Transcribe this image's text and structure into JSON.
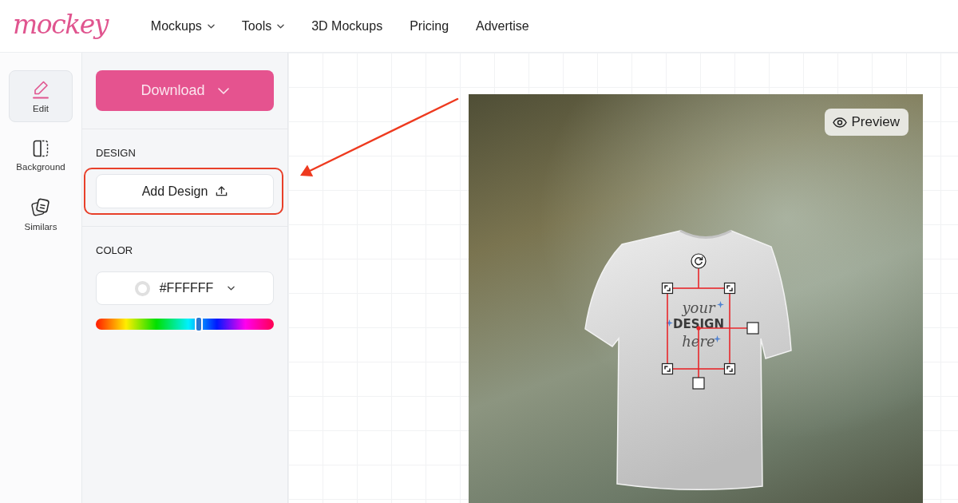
{
  "header": {
    "logo": "mockey",
    "nav": [
      {
        "label": "Mockups",
        "dropdown": true
      },
      {
        "label": "Tools",
        "dropdown": true
      },
      {
        "label": "3D Mockups",
        "dropdown": false
      },
      {
        "label": "Pricing",
        "dropdown": false
      },
      {
        "label": "Advertise",
        "dropdown": false
      }
    ]
  },
  "rail": {
    "items": [
      {
        "kind": "edit",
        "label": "Edit",
        "selected": true
      },
      {
        "kind": "background",
        "label": "Background",
        "selected": false
      },
      {
        "kind": "similars",
        "label": "Similars",
        "selected": false
      }
    ]
  },
  "panel": {
    "download_button": {
      "label": "Download",
      "dropdown": true
    },
    "sections": [
      {
        "kind": "design",
        "title": "DESIGN",
        "button": {
          "label": "Add Design",
          "highlighted": true
        }
      },
      {
        "kind": "color",
        "title": "COLOR",
        "value": "#FFFFFF",
        "color": "#ffffff",
        "hue_slider": {
          "level": 0.58
        }
      }
    ]
  },
  "canvas": {
    "annotation_arrow": true,
    "preview_button": {
      "label": "Preview"
    },
    "design_placeholder": {
      "selected": true,
      "lines": [
        {
          "text": "your",
          "kind": "script"
        },
        {
          "text": "DESIGN",
          "kind": "bold"
        },
        {
          "text": "here",
          "kind": "script"
        }
      ]
    }
  }
}
